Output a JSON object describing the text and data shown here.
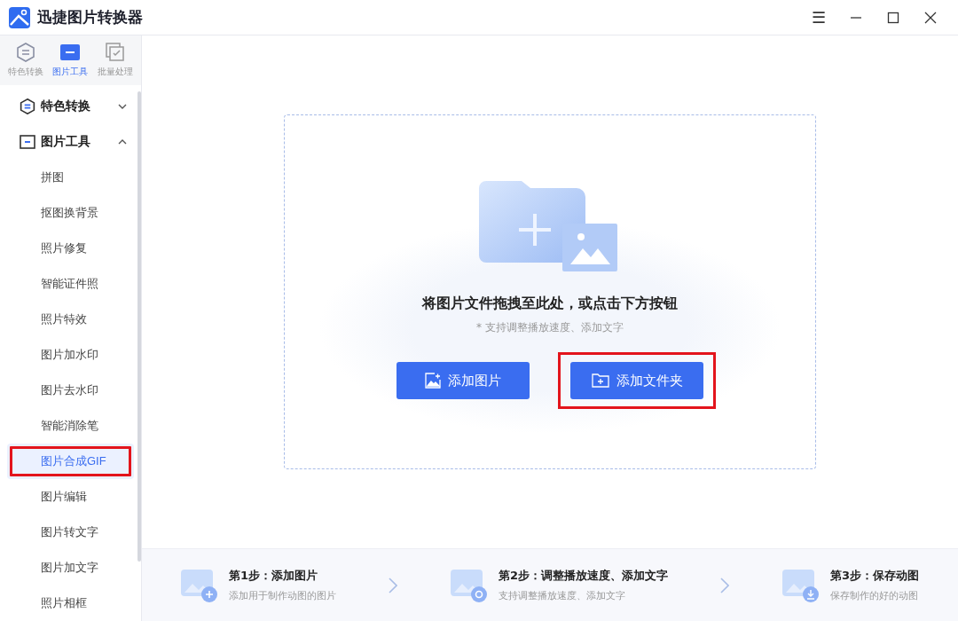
{
  "window": {
    "title": "迅捷图片转换器",
    "controls": [
      "☰"
    ]
  },
  "mode_tabs": [
    {
      "label": "特色转换",
      "kind": "convert",
      "selected": false
    },
    {
      "label": "图片工具",
      "kind": "tools",
      "selected": true
    },
    {
      "label": "批量处理",
      "kind": "batch",
      "selected": false
    }
  ],
  "nav": [
    {
      "label": "特色转换",
      "kind": "convert",
      "expanded": false
    },
    {
      "label": "图片工具",
      "kind": "tools",
      "expanded": true,
      "children": [
        {
          "label": "拼图",
          "selected": false,
          "annotated": false
        },
        {
          "label": "抠图换背景",
          "selected": false,
          "annotated": false
        },
        {
          "label": "照片修复",
          "selected": false,
          "annotated": false
        },
        {
          "label": "智能证件照",
          "selected": false,
          "annotated": false
        },
        {
          "label": "照片特效",
          "selected": false,
          "annotated": false
        },
        {
          "label": "图片加水印",
          "selected": false,
          "annotated": false
        },
        {
          "label": "图片去水印",
          "selected": false,
          "annotated": false
        },
        {
          "label": "智能消除笔",
          "selected": false,
          "annotated": false
        },
        {
          "label": "图片合成GIF",
          "selected": true,
          "annotated": true
        },
        {
          "label": "图片编辑",
          "selected": false,
          "annotated": false
        },
        {
          "label": "图片转文字",
          "selected": false,
          "annotated": false
        },
        {
          "label": "图片加文字",
          "selected": false,
          "annotated": false
        },
        {
          "label": "照片相框",
          "selected": false,
          "annotated": false
        }
      ]
    }
  ],
  "drop_zone": {
    "heading": "将图片文件拖拽至此处，或点击下方按钮",
    "hint": "* 支持调整播放速度、添加文字",
    "buttons": [
      {
        "label": "添加图片",
        "kind": "image",
        "annotated": false
      },
      {
        "label": "添加文件夹",
        "kind": "folder",
        "annotated": true
      }
    ]
  },
  "steps": [
    {
      "title": "第1步：添加图片",
      "description": "添加用于制作动图的图片",
      "kind": "add"
    },
    {
      "title": "第2步：调整播放速度、添加文字",
      "description": "支持调整播放速度、添加文字",
      "kind": "edit"
    },
    {
      "title": "第3步：保存动图",
      "description": "保存制作的好的动图",
      "kind": "save"
    }
  ]
}
